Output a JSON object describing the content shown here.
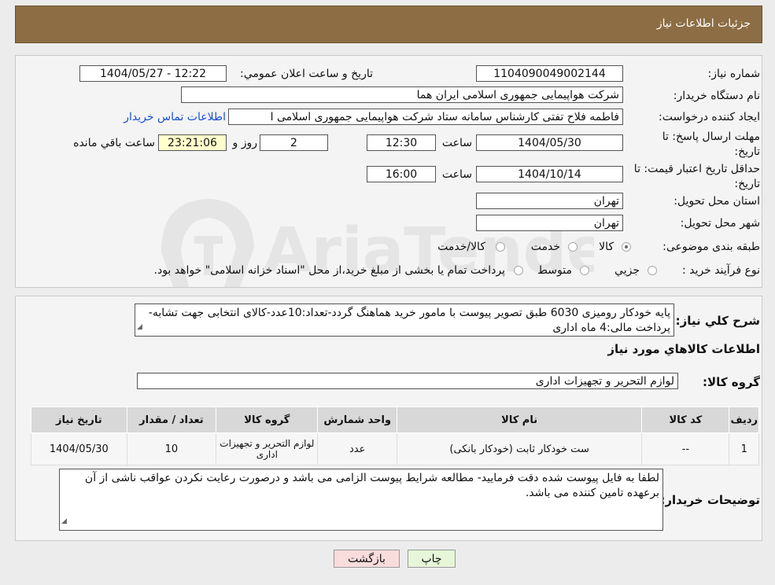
{
  "header": {
    "title": "جزئیات اطلاعات نیاز"
  },
  "fields": {
    "need_number_label": "شماره نیاز:",
    "need_number": "1104090049002144",
    "announce_label": "تاریخ و ساعت اعلان عمومي:",
    "announce_value": "1404/05/27 - 12:22",
    "buyer_org_label": "نام دستگاه خریدار:",
    "buyer_org": "شرکت هواپیمایی جمهوری اسلامی ایران هما",
    "creator_label": "ایجاد کننده درخواست:",
    "creator": "فاطمه فلاح تفتی کارشناس سامانه ستاد شرکت هواپیمایی جمهوری اسلامی ا",
    "contact_link": "اطلاعات تماس خریدار",
    "deadline_label": "مهلت ارسال پاسخ: تا تاریخ:",
    "deadline_date": "1404/05/30",
    "time_label": "ساعت",
    "deadline_time": "12:30",
    "days_value": "2",
    "days_label": "روز و",
    "remaining_time": "23:21:06",
    "remaining_label": "ساعت باقي مانده",
    "validity_label": "حداقل تاریخ اعتبار قیمت: تا تاریخ:",
    "validity_date": "1404/10/14",
    "validity_time": "16:00",
    "province_label": "استان محل تحویل:",
    "province": "تهران",
    "city_label": "شهر محل تحویل:",
    "city": "تهران",
    "category_label": "طبقه بندی موضوعی:",
    "category_options": [
      "کالا",
      "خدمت",
      "کالا/خدمت"
    ],
    "process_label": "نوع فرآیند خرید :",
    "process_options": [
      "جزیي",
      "متوسط"
    ],
    "process_note": "پرداخت تمام یا بخشی از مبلغ خرید،از محل \"اسناد خزانه اسلامی\" خواهد بود."
  },
  "summary": {
    "label": "شرح کلي نیاز:",
    "text": "پایه خودکار رومیزی 6030 طبق تصویر پیوست با مامور خرید هماهنگ گردد-تعداد:10عدد-کالای انتخابی جهت تشابه-پرداخت مالی:4 ماه اداری",
    "goods_info_title": "اطلاعات کالاهاي مورد نیاز",
    "goods_group_label": "گروه کالا:",
    "goods_group": "لوازم التحریر و تجهیزات اداری"
  },
  "table": {
    "headers": [
      "ردیف",
      "کد کالا",
      "نام کالا",
      "واحد شمارش",
      "گروه کالا",
      "تعداد / مقدار",
      "تاریخ نیاز"
    ],
    "rows": [
      [
        "1",
        "--",
        "ست خودکار ثابت (خودکار بانکی)",
        "عدد",
        "لوازم التحریر و تجهیزات اداری",
        "10",
        "1404/05/30"
      ]
    ]
  },
  "buyer_notes": {
    "label": "توضیحات خریدار:",
    "text": "لطفا به فایل پیوست شده دقت فرمایید- مطالعه شرایط پیوست الزامی می باشد و درصورت رعایت نکردن عواقب ناشی از آن برعهده تامین کننده می باشد."
  },
  "buttons": {
    "print": "چاپ",
    "back": "بازگشت"
  },
  "watermark": "AriaTender.neT",
  "colors": {
    "header": "#8c6d44",
    "print_btn": "#e6f7d9",
    "back_btn": "#f9dcdc",
    "link": "#1a4fd6"
  }
}
